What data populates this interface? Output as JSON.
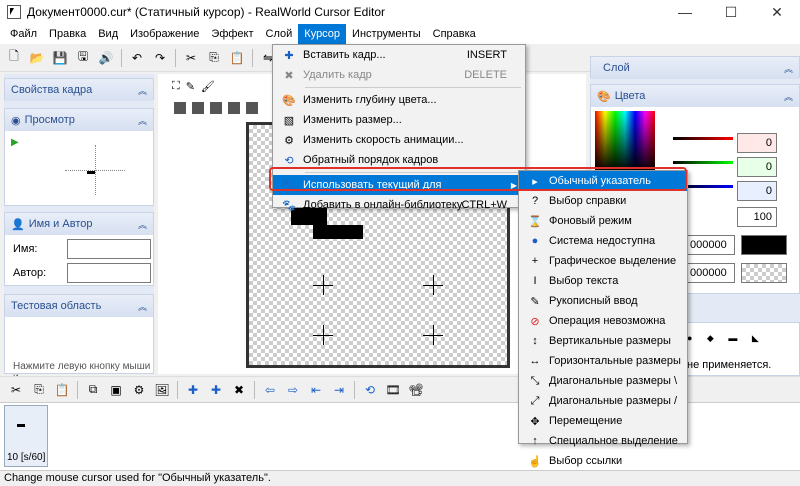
{
  "window": {
    "title": "Документ0000.cur* (Статичный курсор) - RealWorld Cursor Editor",
    "controls": [
      "—",
      "☐",
      "✕"
    ]
  },
  "menubar": [
    "Файл",
    "Правка",
    "Вид",
    "Изображение",
    "Эффект",
    "Слой",
    "Курсор",
    "Инструменты",
    "Справка"
  ],
  "active_menu": "Курсор",
  "left_panels": {
    "frame_props": "Свойства кадра",
    "preview": "Просмотр",
    "name_author": "Имя и Автор",
    "name_label": "Имя:",
    "author_label": "Автор:",
    "test_area": "Тестовая область",
    "test_hint": "Нажмите левую кнопку мыши и"
  },
  "right_panels": {
    "layer": "Слой",
    "colors": "Цвета",
    "values": [
      "0",
      "0",
      "0",
      "100"
    ],
    "hex1": "000000",
    "hex2": "000000",
    "not_applied": "не применяется."
  },
  "cursor_menu": {
    "items": [
      {
        "label": "Вставить кадр...",
        "shortcut": "INSERT",
        "icon": "insert-frame-icon",
        "disabled": false
      },
      {
        "label": "Удалить кадр",
        "shortcut": "DELETE",
        "icon": "delete-frame-icon",
        "disabled": true
      },
      {
        "label": "Изменить глубину цвета...",
        "shortcut": "",
        "icon": "color-depth-icon",
        "disabled": false
      },
      {
        "label": "Изменить размер...",
        "shortcut": "",
        "icon": "resize-icon",
        "disabled": false
      },
      {
        "label": "Изменить скорость анимации...",
        "shortcut": "",
        "icon": "animation-speed-icon",
        "disabled": false
      },
      {
        "label": "Обратный порядок кадров",
        "shortcut": "",
        "icon": "reverse-order-icon",
        "disabled": false
      },
      {
        "label": "Использовать текущий для",
        "shortcut": "",
        "icon": "use-current-icon",
        "disabled": false
      },
      {
        "label": "Добавить в онлайн-библиотеку",
        "shortcut": "CTRL+W",
        "icon": "online-library-icon",
        "disabled": false
      }
    ]
  },
  "submenu": {
    "items": [
      "Обычный указатель",
      "Выбор справки",
      "Фоновый режим",
      "Система недоступна",
      "Графическое выделение",
      "Выбор текста",
      "Рукописный ввод",
      "Операция невозможна",
      "Вертикальные размеры",
      "Горизонтальные размеры",
      "Диагональные размеры \\",
      "Диагональные размеры /",
      "Перемещение",
      "Специальное выделение",
      "Выбор ссылки"
    ]
  },
  "frame_strip": {
    "label": "10 [s/60]"
  },
  "status": "Change mouse cursor used for \"Обычный указатель\".",
  "colors": {
    "accent": "#0078d7",
    "highlight_ring": "#e0302a",
    "panel_head": "#2a4f8f"
  }
}
